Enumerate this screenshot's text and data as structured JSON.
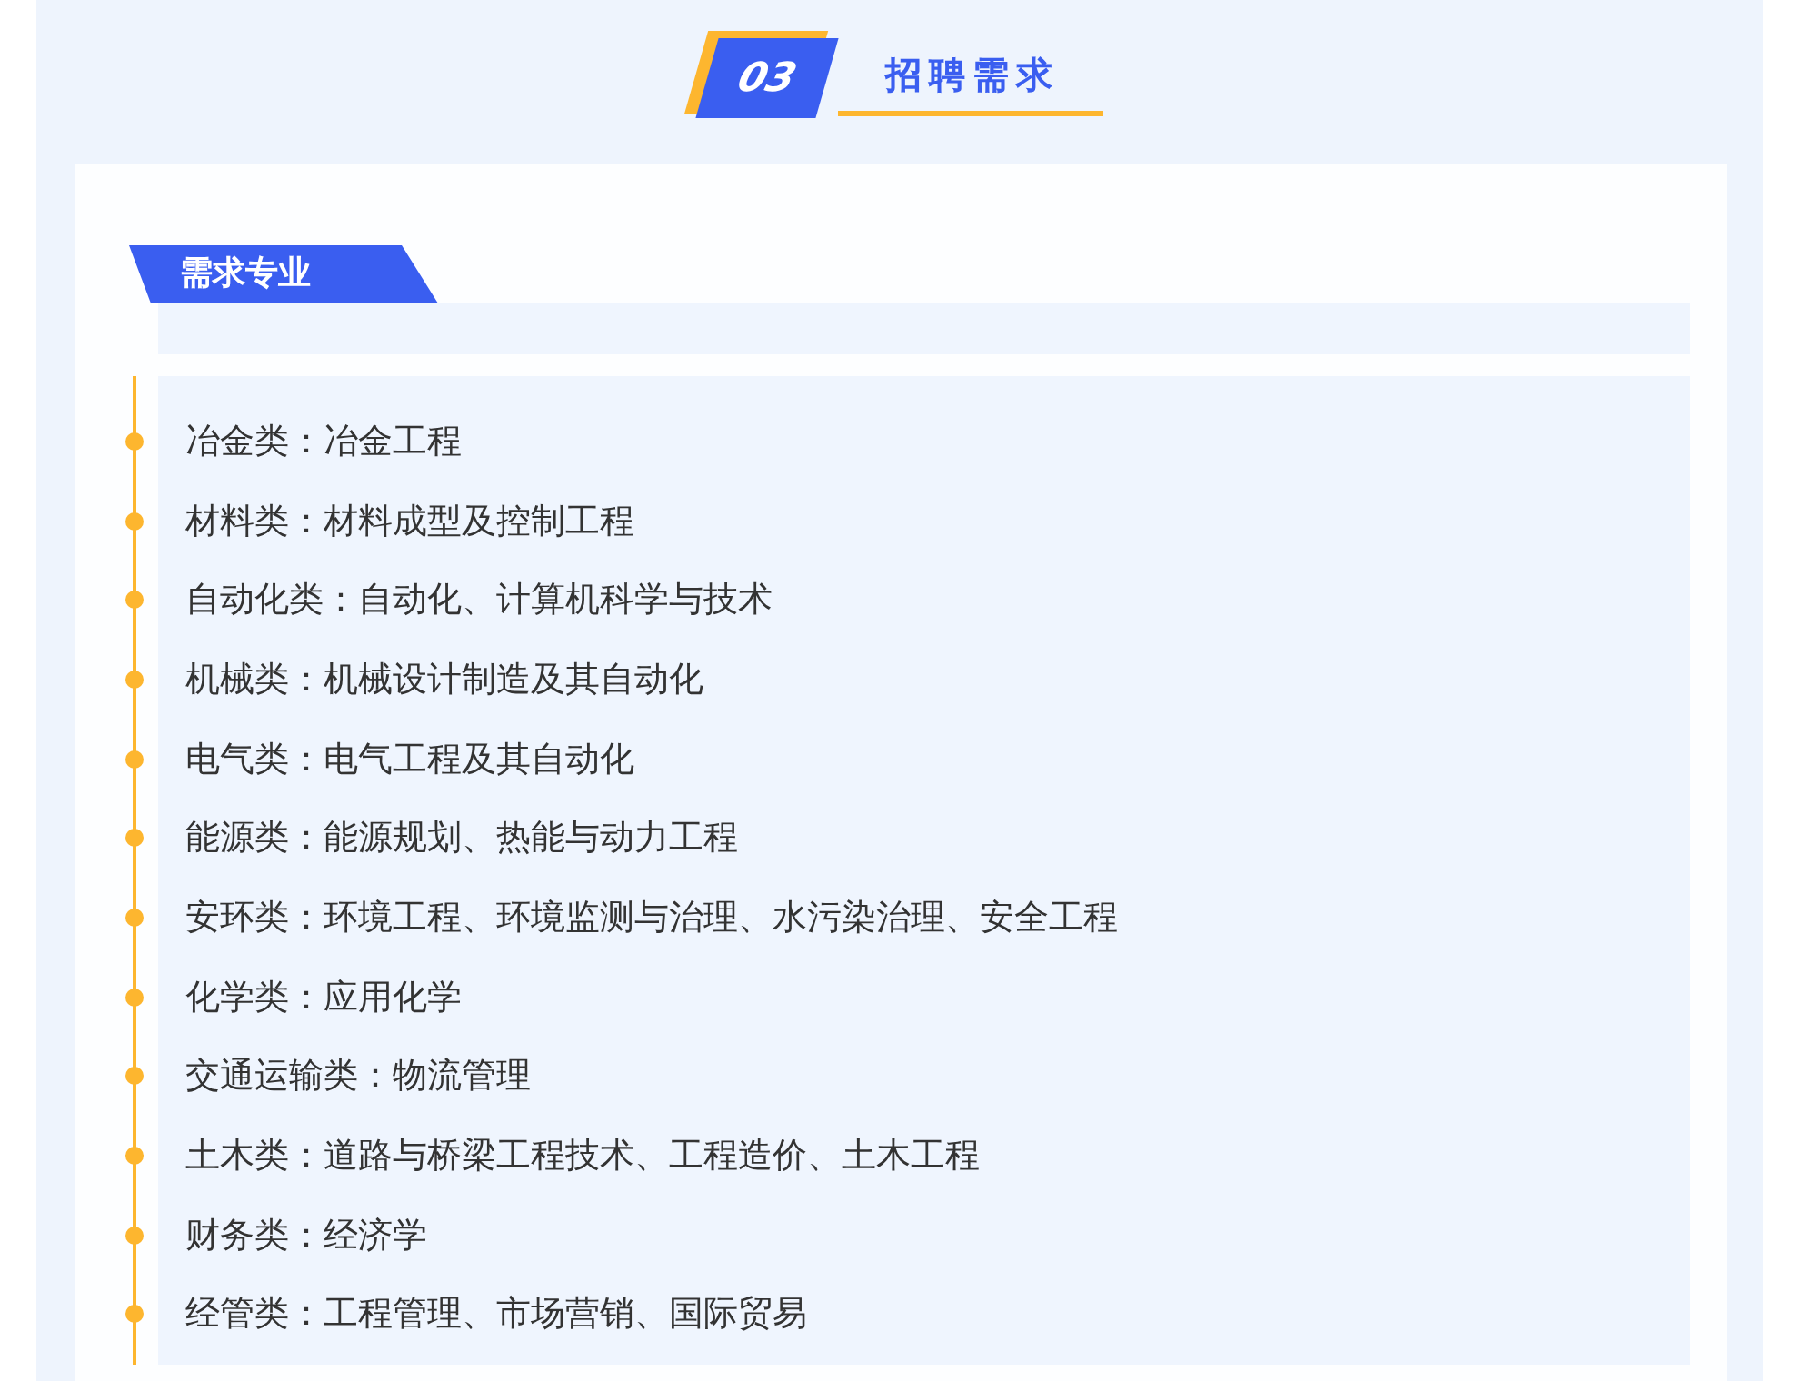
{
  "section": {
    "number": "03",
    "title": "招聘需求"
  },
  "tab": {
    "label": "需求专业"
  },
  "majors": [
    {
      "category": "冶金类：",
      "fields": "冶金工程"
    },
    {
      "category": "材料类：",
      "fields": "材料成型及控制工程"
    },
    {
      "category": "自动化类：",
      "fields": "自动化、计算机科学与技术"
    },
    {
      "category": "机械类：",
      "fields": "机械设计制造及其自动化"
    },
    {
      "category": "电气类：",
      "fields": "电气工程及其自动化"
    },
    {
      "category": "能源类：",
      "fields": "能源规划、热能与动力工程"
    },
    {
      "category": "安环类：",
      "fields": "环境工程、环境监测与治理、水污染治理、安全工程"
    },
    {
      "category": "化学类：",
      "fields": "应用化学"
    },
    {
      "category": "交通运输类：",
      "fields": "物流管理"
    },
    {
      "category": "土木类：",
      "fields": "道路与桥梁工程技术、工程造价、土木工程"
    },
    {
      "category": "财务类：",
      "fields": "经济学"
    },
    {
      "category": "经管类：",
      "fields": "工程管理、市场营销、国际贸易"
    }
  ]
}
